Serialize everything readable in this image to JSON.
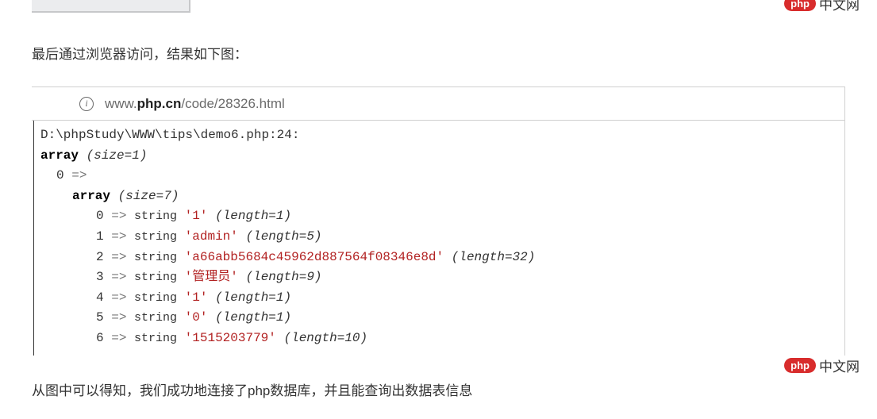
{
  "intro": "最后通过浏览器访问，结果如下图：",
  "url": {
    "prefix": "www.",
    "domain": "php.cn",
    "path": "/code/28326.html"
  },
  "dump": {
    "path": "D:\\phpStudy\\WWW\\tips\\demo6.php:24:",
    "outer": {
      "size": "1"
    },
    "inner": {
      "index": "0",
      "size": "7"
    },
    "rows": [
      {
        "idx": "0",
        "val": "1",
        "len": "1"
      },
      {
        "idx": "1",
        "val": "admin",
        "len": "5"
      },
      {
        "idx": "2",
        "val": "a66abb5684c45962d887564f08346e8d",
        "len": "32"
      },
      {
        "idx": "3",
        "val": "管理员",
        "len": "9"
      },
      {
        "idx": "4",
        "val": "1",
        "len": "1"
      },
      {
        "idx": "5",
        "val": "0",
        "len": "1"
      },
      {
        "idx": "6",
        "val": "1515203779",
        "len": "10"
      }
    ]
  },
  "bottom": "从图中可以得知，我们成功地连接了php数据库，并且能查询出数据表信息",
  "watermark": {
    "badge": "php",
    "text": "中文网"
  }
}
